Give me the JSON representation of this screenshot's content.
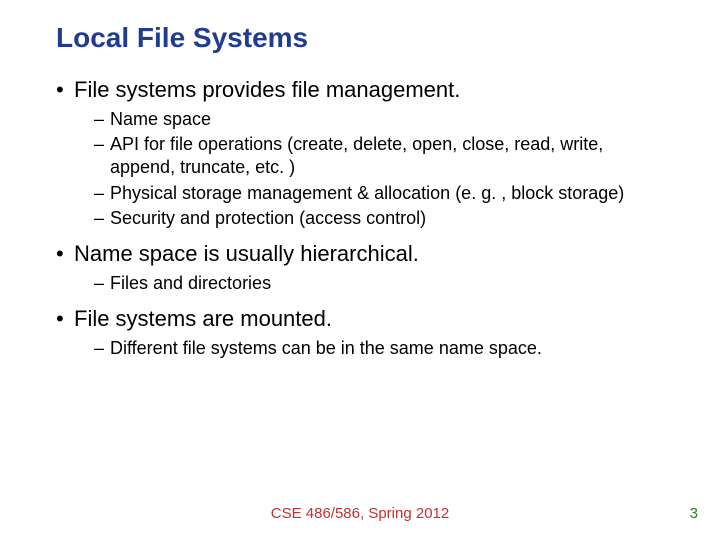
{
  "title": "Local File Systems",
  "bullets": {
    "b1": "File systems provides file management.",
    "b1_subs": {
      "s1": "Name space",
      "s2": "API for file operations (create, delete, open, close, read, write, append, truncate, etc. )",
      "s3": "Physical storage management & allocation (e. g. , block storage)",
      "s4": "Security and protection (access control)"
    },
    "b2": "Name space is usually hierarchical.",
    "b2_subs": {
      "s1": "Files and directories"
    },
    "b3": "File systems are mounted.",
    "b3_subs": {
      "s1": "Different file systems can be in the same name space."
    }
  },
  "footer": "CSE 486/586, Spring 2012",
  "page_number": "3"
}
